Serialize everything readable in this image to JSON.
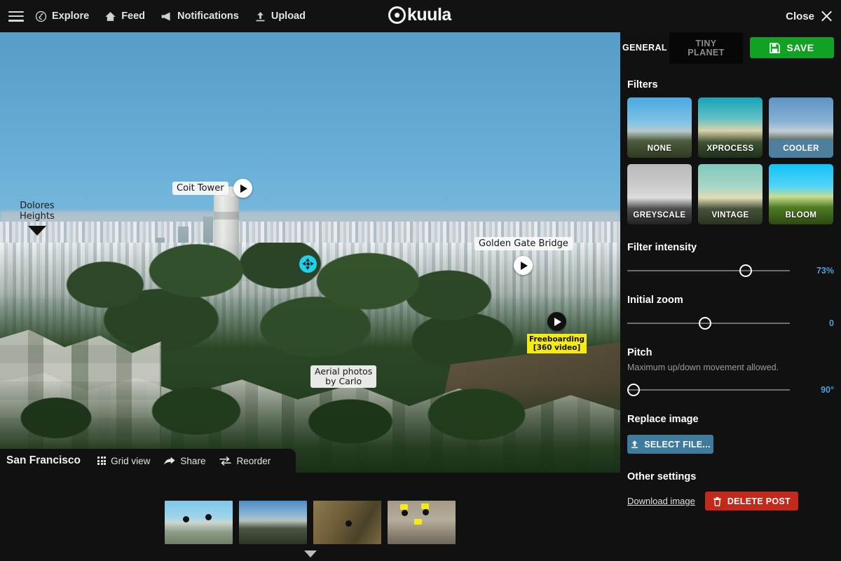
{
  "nav": {
    "menu_icon": "hamburger-icon",
    "items": [
      {
        "label": "Explore",
        "icon": "globe-icon"
      },
      {
        "label": "Feed",
        "icon": "home-icon"
      },
      {
        "label": "Notifications",
        "icon": "megaphone-icon"
      },
      {
        "label": "Upload",
        "icon": "upload-icon"
      }
    ],
    "brand": "kuula",
    "close_label": "Close"
  },
  "panorama": {
    "title": "San Francisco",
    "actions": [
      {
        "label": "Grid view",
        "icon": "grid-icon"
      },
      {
        "label": "Share",
        "icon": "share-arrow-icon"
      },
      {
        "label": "Reorder",
        "icon": "reorder-icon"
      }
    ],
    "hotspots": {
      "coit_tower": "Coit Tower",
      "dolores_line1": "Dolores",
      "dolores_line2": "Heights",
      "golden_gate": "Golden Gate Bridge",
      "freeboarding_line1": "Freeboarding",
      "freeboarding_line2": "[360 video]",
      "aerial_line1": "Aerial photos",
      "aerial_line2": "by Carlo"
    }
  },
  "thumbnails": [
    {
      "name": "thumbnail-1"
    },
    {
      "name": "thumbnail-2"
    },
    {
      "name": "thumbnail-3"
    },
    {
      "name": "thumbnail-4"
    }
  ],
  "panel": {
    "tabs": [
      {
        "label": "GENERAL",
        "active": true
      },
      {
        "label": "TINY\nPLANET",
        "line1": "TINY",
        "line2": "PLANET",
        "active": false
      }
    ],
    "save_label": "SAVE",
    "filters_title": "Filters",
    "filters": [
      {
        "label": "NONE",
        "selected": false
      },
      {
        "label": "XPROCESS",
        "selected": false
      },
      {
        "label": "COOLER",
        "selected": true
      },
      {
        "label": "GREYSCALE",
        "selected": false
      },
      {
        "label": "VINTAGE",
        "selected": false
      },
      {
        "label": "BLOOM",
        "selected": false
      }
    ],
    "filter_intensity": {
      "label": "Filter intensity",
      "value": "73%",
      "percent": 73
    },
    "initial_zoom": {
      "label": "Initial zoom",
      "value": "0",
      "percent": 48
    },
    "pitch": {
      "label": "Pitch",
      "sub": "Maximum up/down movement allowed.",
      "value": "90°",
      "percent": 0
    },
    "replace_image": {
      "label": "Replace image",
      "button": "SELECT FILE..."
    },
    "other_settings": {
      "label": "Other settings",
      "download": "Download image",
      "delete": "DELETE POST"
    },
    "accent_color": "#4a9fd4",
    "save_color": "#12a223",
    "delete_color": "#c3291a",
    "selectfile_color": "#3f7b9d"
  }
}
